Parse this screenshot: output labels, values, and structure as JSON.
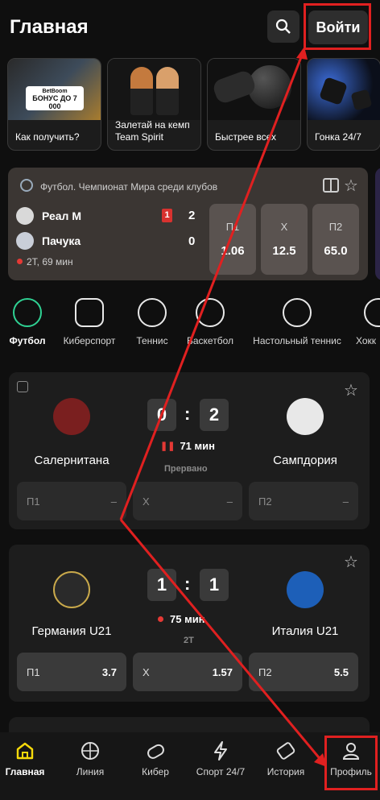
{
  "header": {
    "title": "Главная",
    "login_label": "Войти"
  },
  "stories": [
    {
      "caption": "Как получить?",
      "banner": "БОНУС ДО 7 000",
      "brand": "BetBoom"
    },
    {
      "caption": "Залетай на кемп Team Spirit"
    },
    {
      "caption": "Быстрее всех"
    },
    {
      "caption": "Гонка 24/7"
    }
  ],
  "live_event": {
    "league": "Футбол. Чемпионат Мира среди клубов",
    "home": "Реал М",
    "away": "Пачука",
    "home_score": "2",
    "away_score": "0",
    "red_cards": "1",
    "period": "2Т, 69 мин",
    "odds": [
      {
        "label": "П1",
        "value": "1.06"
      },
      {
        "label": "Х",
        "value": "12.5"
      },
      {
        "label": "П2",
        "value": "65.0"
      }
    ]
  },
  "sports": [
    {
      "label": "Футбол"
    },
    {
      "label": "Киберспорт"
    },
    {
      "label": "Теннис"
    },
    {
      "label": "Баскетбол"
    },
    {
      "label": "Настольный теннис"
    },
    {
      "label": "Хокк"
    }
  ],
  "matches": [
    {
      "home": "Салернитана",
      "away": "Сампдория",
      "home_goals": "0",
      "away_goals": "2",
      "time": "71 мин",
      "status": "Прервано",
      "odds": [
        {
          "label": "П1",
          "value": "–"
        },
        {
          "label": "Х",
          "value": "–"
        },
        {
          "label": "П2",
          "value": "–"
        }
      ]
    },
    {
      "home": "Германия U21",
      "away": "Италия U21",
      "home_goals": "1",
      "away_goals": "1",
      "time": "75 мин",
      "status": "2Т",
      "odds": [
        {
          "label": "П1",
          "value": "3.7"
        },
        {
          "label": "Х",
          "value": "1.57"
        },
        {
          "label": "П2",
          "value": "5.5"
        }
      ]
    }
  ],
  "nav": [
    {
      "label": "Главная"
    },
    {
      "label": "Линия"
    },
    {
      "label": "Кибер"
    },
    {
      "label": "Спорт 24/7"
    },
    {
      "label": "История"
    },
    {
      "label": "Профиль"
    }
  ],
  "colors": {
    "accent_yellow": "#f5d90a",
    "live_red": "#e53935",
    "annotation_red": "#e02020",
    "sport_green": "#2fd193"
  }
}
